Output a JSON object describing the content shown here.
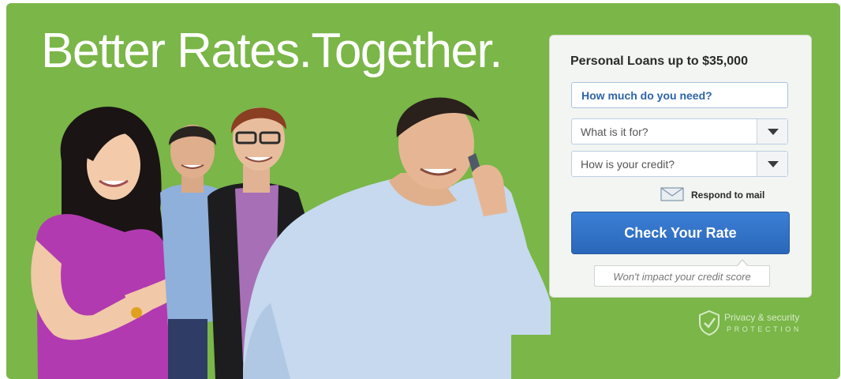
{
  "hero": {
    "headline": "Better Rates.Together.",
    "background_color": "#7ab648"
  },
  "form": {
    "title": "Personal Loans up to $35,000",
    "amount_placeholder": "How much do you need?",
    "purpose_select": {
      "selected": "What is it for?"
    },
    "credit_select": {
      "selected": "How is your credit?"
    },
    "mail_link": "Respond to mail",
    "submit_label": "Check Your Rate",
    "submit_color": "#2f6fc4",
    "tooltip": "Won't impact your credit score"
  },
  "privacy": {
    "line1": "Privacy & security",
    "line2": "PROTECTION"
  },
  "icons": [
    "people-illustration",
    "mail-icon",
    "dropdown-arrow-icon",
    "shield-check-icon"
  ]
}
